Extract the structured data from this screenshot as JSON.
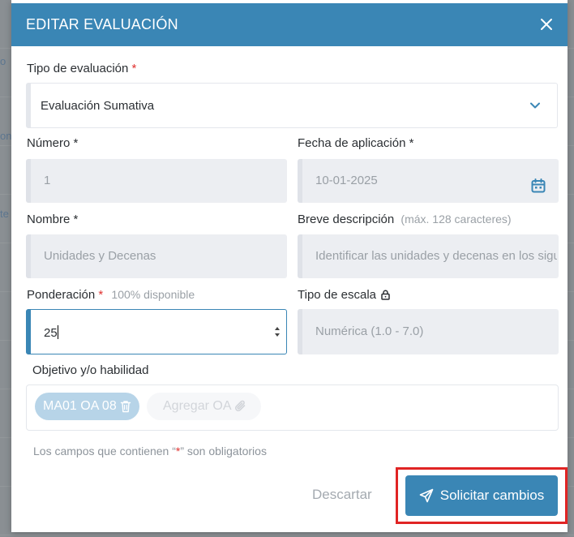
{
  "background": {
    "fragments": [
      "o",
      "on",
      "te"
    ]
  },
  "modal": {
    "title": "EDITAR EVALUACIÓN",
    "colors": {
      "header": "#3a86b5",
      "required": "#e0312f",
      "highlight": "#e02424"
    }
  },
  "form": {
    "tipo": {
      "label": "Tipo de evaluación",
      "required_mark": "*",
      "value": "Evaluación Sumativa"
    },
    "numero": {
      "label": "Número *",
      "value": "1"
    },
    "fecha": {
      "label": "Fecha de aplicación *",
      "value": "10-01-2025"
    },
    "nombre": {
      "label": "Nombre *",
      "value": "Unidades y Decenas"
    },
    "descripcion": {
      "label": "Breve descripción",
      "hint": "(máx. 128 caracteres)",
      "value": "Identificar las unidades y decenas en los sigu"
    },
    "ponderacion": {
      "label": "Ponderación",
      "required_mark": "*",
      "hint": "100% disponible",
      "value": "25"
    },
    "escala": {
      "label": "Tipo de escala",
      "value": "Numérica (1.0 - 7.0)"
    },
    "objetivo": {
      "label": "Objetivo y/o habilidad",
      "chips": [
        "MA01 OA 08"
      ],
      "add_label": "Agregar OA"
    }
  },
  "footnote": {
    "before": "Los campos que contienen “",
    "star": "*",
    "after": "” son obligatorios"
  },
  "actions": {
    "discard": "Descartar",
    "submit": "Solicitar cambios"
  }
}
